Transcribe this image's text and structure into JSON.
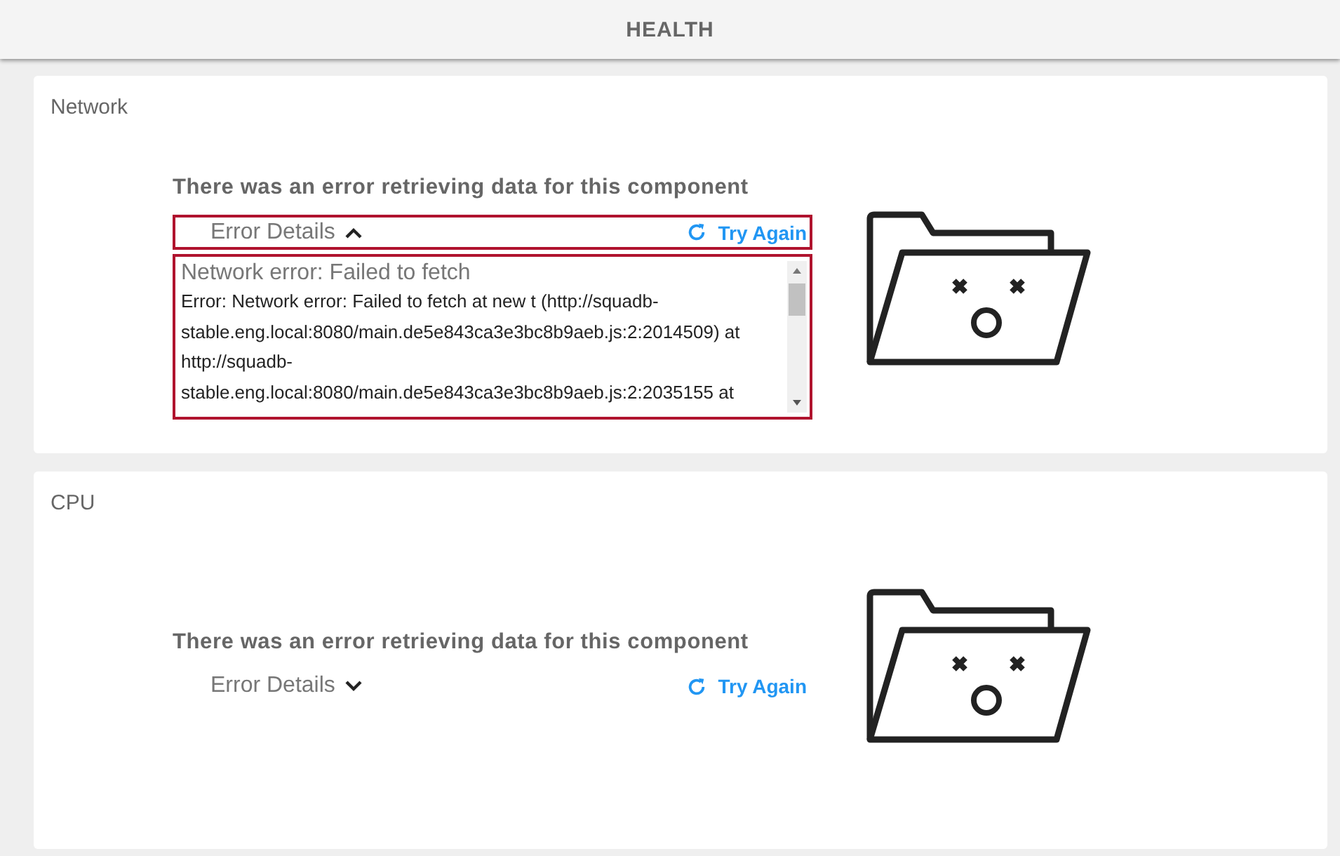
{
  "header": {
    "title": "HEALTH"
  },
  "panels": [
    {
      "title": "Network",
      "message": "There was an error retrieving data for this component",
      "details_label": "Error Details",
      "expanded": true,
      "retry_label": "Try Again",
      "error_title": "Network error: Failed to fetch",
      "error_lines": [
        "Error: Network error: Failed to fetch at new t (http://squadb-",
        "stable.eng.local:8080/main.de5e843ca3e3bc8b9aeb.js:2:2014509) at",
        "http://squadb-",
        "stable.eng.local:8080/main.de5e843ca3e3bc8b9aeb.js:2:2035155 at"
      ]
    },
    {
      "title": "CPU",
      "message": "There was an error retrieving data for this component",
      "details_label": "Error Details",
      "expanded": false,
      "retry_label": "Try Again"
    }
  ]
}
